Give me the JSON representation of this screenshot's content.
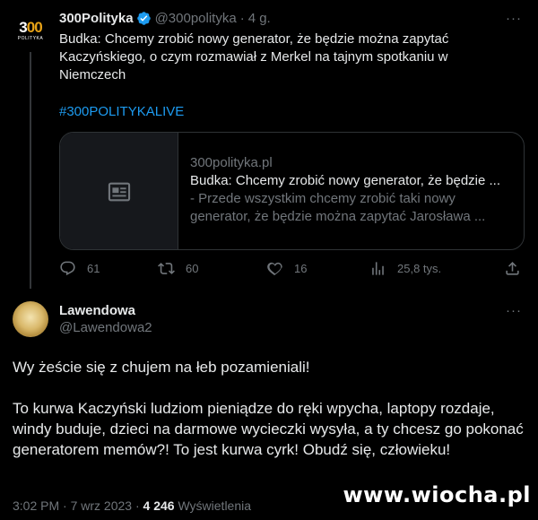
{
  "quoted_tweet": {
    "avatar_text_main": "300",
    "avatar_text_sub": "POLITYKA",
    "author_name": "300Polityka",
    "handle": "@300polityka",
    "separator": "·",
    "time_ago": "4 g.",
    "text": "Budka: Chcemy zrobić nowy generator, że będzie można zapytać Kaczyńskiego, o czym rozmawiał z Merkel na tajnym spotkaniu w Niemczech",
    "hashtag": "#300POLITYKALIVE",
    "card": {
      "domain": "300polityka.pl",
      "title": "Budka: Chcemy zrobić nowy generator, że będzie ...",
      "description": "- Przede wszystkim chcemy zrobić taki nowy generator, że będzie można zapytać Jarosława ..."
    },
    "stats": {
      "replies": "61",
      "retweets": "60",
      "likes": "16",
      "views": "25,8 tys."
    }
  },
  "reply_tweet": {
    "author_name": "Lawendowa",
    "handle": "@Lawendowa2",
    "paragraph_1": "Wy żeście się z chujem na łeb pozamieniali!",
    "paragraph_2": "To kurwa Kaczyński ludziom pieniądze do ręki wpycha, laptopy rozdaje, windy buduje, dzieci na darmowe wycieczki wysyła, a ty chcesz go pokonać generatorem memów?! To jest kurwa cyrk! Obudź się, człowieku!",
    "timestamp": "3:02 PM · 7 wrz 2023 · ",
    "views_count": "4 246",
    "views_label": " Wyświetlenia"
  },
  "watermark": "www.wiocha.pl",
  "colors": {
    "background": "#000000",
    "text": "#e7e9ea",
    "muted": "#71767b",
    "accent": "#1d9bf0"
  }
}
